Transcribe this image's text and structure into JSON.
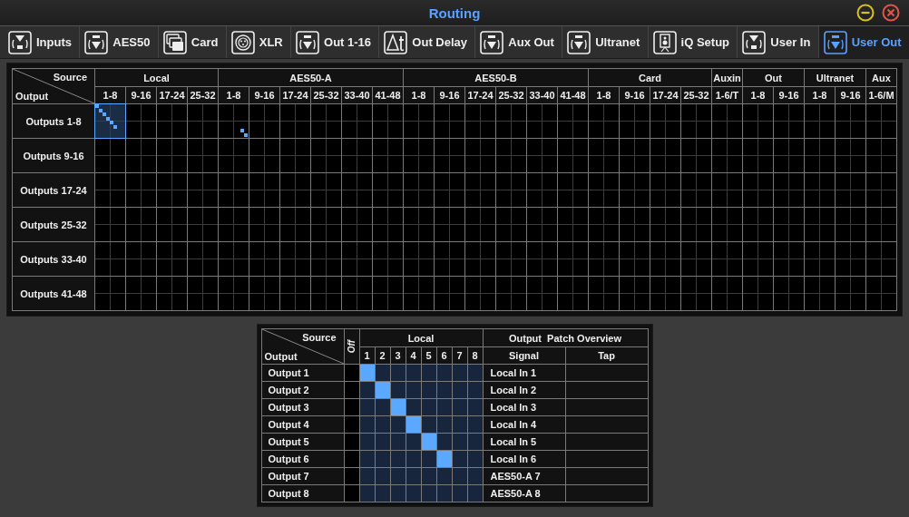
{
  "window": {
    "title": "Routing"
  },
  "tabs": [
    {
      "label": "Inputs",
      "kind": "in",
      "selected": false
    },
    {
      "label": "AES50",
      "kind": "out",
      "selected": false
    },
    {
      "label": "Card",
      "kind": "card",
      "selected": false
    },
    {
      "label": "XLR",
      "kind": "xlr",
      "selected": false
    },
    {
      "label": "Out 1-16",
      "kind": "out",
      "selected": false
    },
    {
      "label": "Out Delay",
      "kind": "delta",
      "selected": false
    },
    {
      "label": "Aux Out",
      "kind": "out",
      "selected": false
    },
    {
      "label": "Ultranet",
      "kind": "out",
      "selected": false
    },
    {
      "label": "iQ Setup",
      "kind": "speaker",
      "selected": false
    },
    {
      "label": "User In",
      "kind": "in",
      "selected": false
    },
    {
      "label": "User Out",
      "kind": "out",
      "selected": true
    }
  ],
  "matrix": {
    "corner_source": "Source",
    "corner_output": "Output",
    "groups": [
      {
        "label": "Local",
        "columns": [
          "1-8",
          "9-16",
          "17-24",
          "25-32"
        ]
      },
      {
        "label": "AES50-A",
        "columns": [
          "1-8",
          "9-16",
          "17-24",
          "25-32",
          "33-40",
          "41-48"
        ]
      },
      {
        "label": "AES50-B",
        "columns": [
          "1-8",
          "9-16",
          "17-24",
          "25-32",
          "33-40",
          "41-48"
        ]
      },
      {
        "label": "Card",
        "columns": [
          "1-8",
          "9-16",
          "17-24",
          "25-32"
        ]
      },
      {
        "label": "Auxin",
        "columns": [
          "1-6/T"
        ]
      },
      {
        "label": "Out",
        "columns": [
          "1-8",
          "9-16"
        ]
      },
      {
        "label": "Ultranet",
        "columns": [
          "1-8",
          "9-16"
        ]
      },
      {
        "label": "Aux",
        "columns": [
          "1-6/M"
        ]
      }
    ],
    "rows": [
      {
        "label": "Outputs 1-8",
        "outputs": [
          {
            "kind": "local"
          },
          {
            "kind": "local"
          },
          {
            "kind": "local"
          },
          {
            "kind": "local"
          },
          {
            "kind": "local"
          },
          {
            "kind": "local"
          },
          {
            "kind": "aes50a"
          },
          {
            "kind": "aes50a"
          }
        ],
        "cells": [
          {
            "selected": true
          },
          {
            "selected": false
          },
          {
            "selected": false
          },
          {
            "selected": false
          },
          {
            "selected": false
          },
          {
            "selected": false
          },
          {
            "selected": false
          },
          {
            "selected": false
          },
          {
            "selected": false
          },
          {
            "selected": false
          },
          {
            "selected": false
          },
          {
            "selected": false
          },
          {
            "selected": false
          },
          {
            "selected": false
          },
          {
            "selected": false
          },
          {
            "selected": false
          },
          {
            "selected": false
          },
          {
            "selected": false
          },
          {
            "selected": false
          },
          {
            "selected": false
          },
          {
            "selected": false
          },
          {
            "selected": false
          },
          {
            "selected": false
          },
          {
            "selected": false
          },
          {
            "selected": false
          },
          {
            "selected": false
          }
        ]
      },
      {
        "label": "Outputs 9-16",
        "cells": [
          {
            "selected": false
          },
          {
            "selected": false
          },
          {
            "selected": false
          },
          {
            "selected": false
          },
          {
            "selected": false
          },
          {
            "selected": false
          },
          {
            "selected": false
          },
          {
            "selected": false
          },
          {
            "selected": false
          },
          {
            "selected": false
          },
          {
            "selected": false
          },
          {
            "selected": false
          },
          {
            "selected": false
          },
          {
            "selected": false
          },
          {
            "selected": false
          },
          {
            "selected": false
          },
          {
            "selected": false
          },
          {
            "selected": false
          },
          {
            "selected": false
          },
          {
            "selected": false
          },
          {
            "selected": false
          },
          {
            "selected": false
          },
          {
            "selected": false
          },
          {
            "selected": false
          },
          {
            "selected": false
          },
          {
            "selected": false
          }
        ]
      },
      {
        "label": "Outputs 17-24",
        "cells": [
          {
            "selected": false
          },
          {
            "selected": false
          },
          {
            "selected": false
          },
          {
            "selected": false
          },
          {
            "selected": false
          },
          {
            "selected": false
          },
          {
            "selected": false
          },
          {
            "selected": false
          },
          {
            "selected": false
          },
          {
            "selected": false
          },
          {
            "selected": false
          },
          {
            "selected": false
          },
          {
            "selected": false
          },
          {
            "selected": false
          },
          {
            "selected": false
          },
          {
            "selected": false
          },
          {
            "selected": false
          },
          {
            "selected": false
          },
          {
            "selected": false
          },
          {
            "selected": false
          },
          {
            "selected": false
          },
          {
            "selected": false
          },
          {
            "selected": false
          },
          {
            "selected": false
          },
          {
            "selected": false
          },
          {
            "selected": false
          }
        ]
      },
      {
        "label": "Outputs 25-32",
        "cells": [
          {
            "selected": false
          },
          {
            "selected": false
          },
          {
            "selected": false
          },
          {
            "selected": false
          },
          {
            "selected": false
          },
          {
            "selected": false
          },
          {
            "selected": false
          },
          {
            "selected": false
          },
          {
            "selected": false
          },
          {
            "selected": false
          },
          {
            "selected": false
          },
          {
            "selected": false
          },
          {
            "selected": false
          },
          {
            "selected": false
          },
          {
            "selected": false
          },
          {
            "selected": false
          },
          {
            "selected": false
          },
          {
            "selected": false
          },
          {
            "selected": false
          },
          {
            "selected": false
          },
          {
            "selected": false
          },
          {
            "selected": false
          },
          {
            "selected": false
          },
          {
            "selected": false
          },
          {
            "selected": false
          },
          {
            "selected": false
          }
        ]
      },
      {
        "label": "Outputs 33-40",
        "cells": [
          {
            "selected": false
          },
          {
            "selected": false
          },
          {
            "selected": false
          },
          {
            "selected": false
          },
          {
            "selected": false
          },
          {
            "selected": false
          },
          {
            "selected": false
          },
          {
            "selected": false
          },
          {
            "selected": false
          },
          {
            "selected": false
          },
          {
            "selected": false
          },
          {
            "selected": false
          },
          {
            "selected": false
          },
          {
            "selected": false
          },
          {
            "selected": false
          },
          {
            "selected": false
          },
          {
            "selected": false
          },
          {
            "selected": false
          },
          {
            "selected": false
          },
          {
            "selected": false
          },
          {
            "selected": false
          },
          {
            "selected": false
          },
          {
            "selected": false
          },
          {
            "selected": false
          },
          {
            "selected": false
          },
          {
            "selected": false
          }
        ]
      },
      {
        "label": "Outputs 41-48",
        "cells": [
          {
            "selected": false
          },
          {
            "selected": false
          },
          {
            "selected": false
          },
          {
            "selected": false
          },
          {
            "selected": false
          },
          {
            "selected": false
          },
          {
            "selected": false
          },
          {
            "selected": false
          },
          {
            "selected": false
          },
          {
            "selected": false
          },
          {
            "selected": false
          },
          {
            "selected": false
          },
          {
            "selected": false
          },
          {
            "selected": false
          },
          {
            "selected": false
          },
          {
            "selected": false
          },
          {
            "selected": false
          },
          {
            "selected": false
          },
          {
            "selected": false
          },
          {
            "selected": false
          },
          {
            "selected": false
          },
          {
            "selected": false
          },
          {
            "selected": false
          },
          {
            "selected": false
          },
          {
            "selected": false
          },
          {
            "selected": false
          }
        ]
      }
    ]
  },
  "detail": {
    "corner_source": "Source",
    "corner_output": "Output",
    "off_label": "Off",
    "group": "Local",
    "channels": [
      "1",
      "2",
      "3",
      "4",
      "5",
      "6",
      "7",
      "8"
    ],
    "overview": "Output  Patch Overview",
    "signal_header": "Signal",
    "tap_header": "Tap",
    "rows": [
      {
        "label": "Output 1",
        "off": false,
        "patched": [
          true,
          false,
          false,
          false,
          false,
          false,
          false,
          false
        ],
        "signal": "Local In 1"
      },
      {
        "label": "Output 2",
        "off": false,
        "patched": [
          false,
          true,
          false,
          false,
          false,
          false,
          false,
          false
        ],
        "signal": "Local In 2"
      },
      {
        "label": "Output 3",
        "off": false,
        "patched": [
          false,
          false,
          true,
          false,
          false,
          false,
          false,
          false
        ],
        "signal": "Local In 3"
      },
      {
        "label": "Output 4",
        "off": false,
        "patched": [
          false,
          false,
          false,
          true,
          false,
          false,
          false,
          false
        ],
        "signal": "Local In 4"
      },
      {
        "label": "Output 5",
        "off": false,
        "patched": [
          false,
          false,
          false,
          false,
          true,
          false,
          false,
          false
        ],
        "signal": "Local In 5"
      },
      {
        "label": "Output 6",
        "off": false,
        "patched": [
          false,
          false,
          false,
          false,
          false,
          true,
          false,
          false
        ],
        "signal": "Local In 6"
      },
      {
        "label": "Output 7",
        "off": false,
        "patched": [
          false,
          false,
          false,
          false,
          false,
          false,
          false,
          false
        ],
        "signal": "AES50-A 7"
      },
      {
        "label": "Output 8",
        "off": false,
        "patched": [
          false,
          false,
          false,
          false,
          false,
          false,
          false,
          false
        ],
        "signal": "AES50-A 8"
      }
    ]
  }
}
